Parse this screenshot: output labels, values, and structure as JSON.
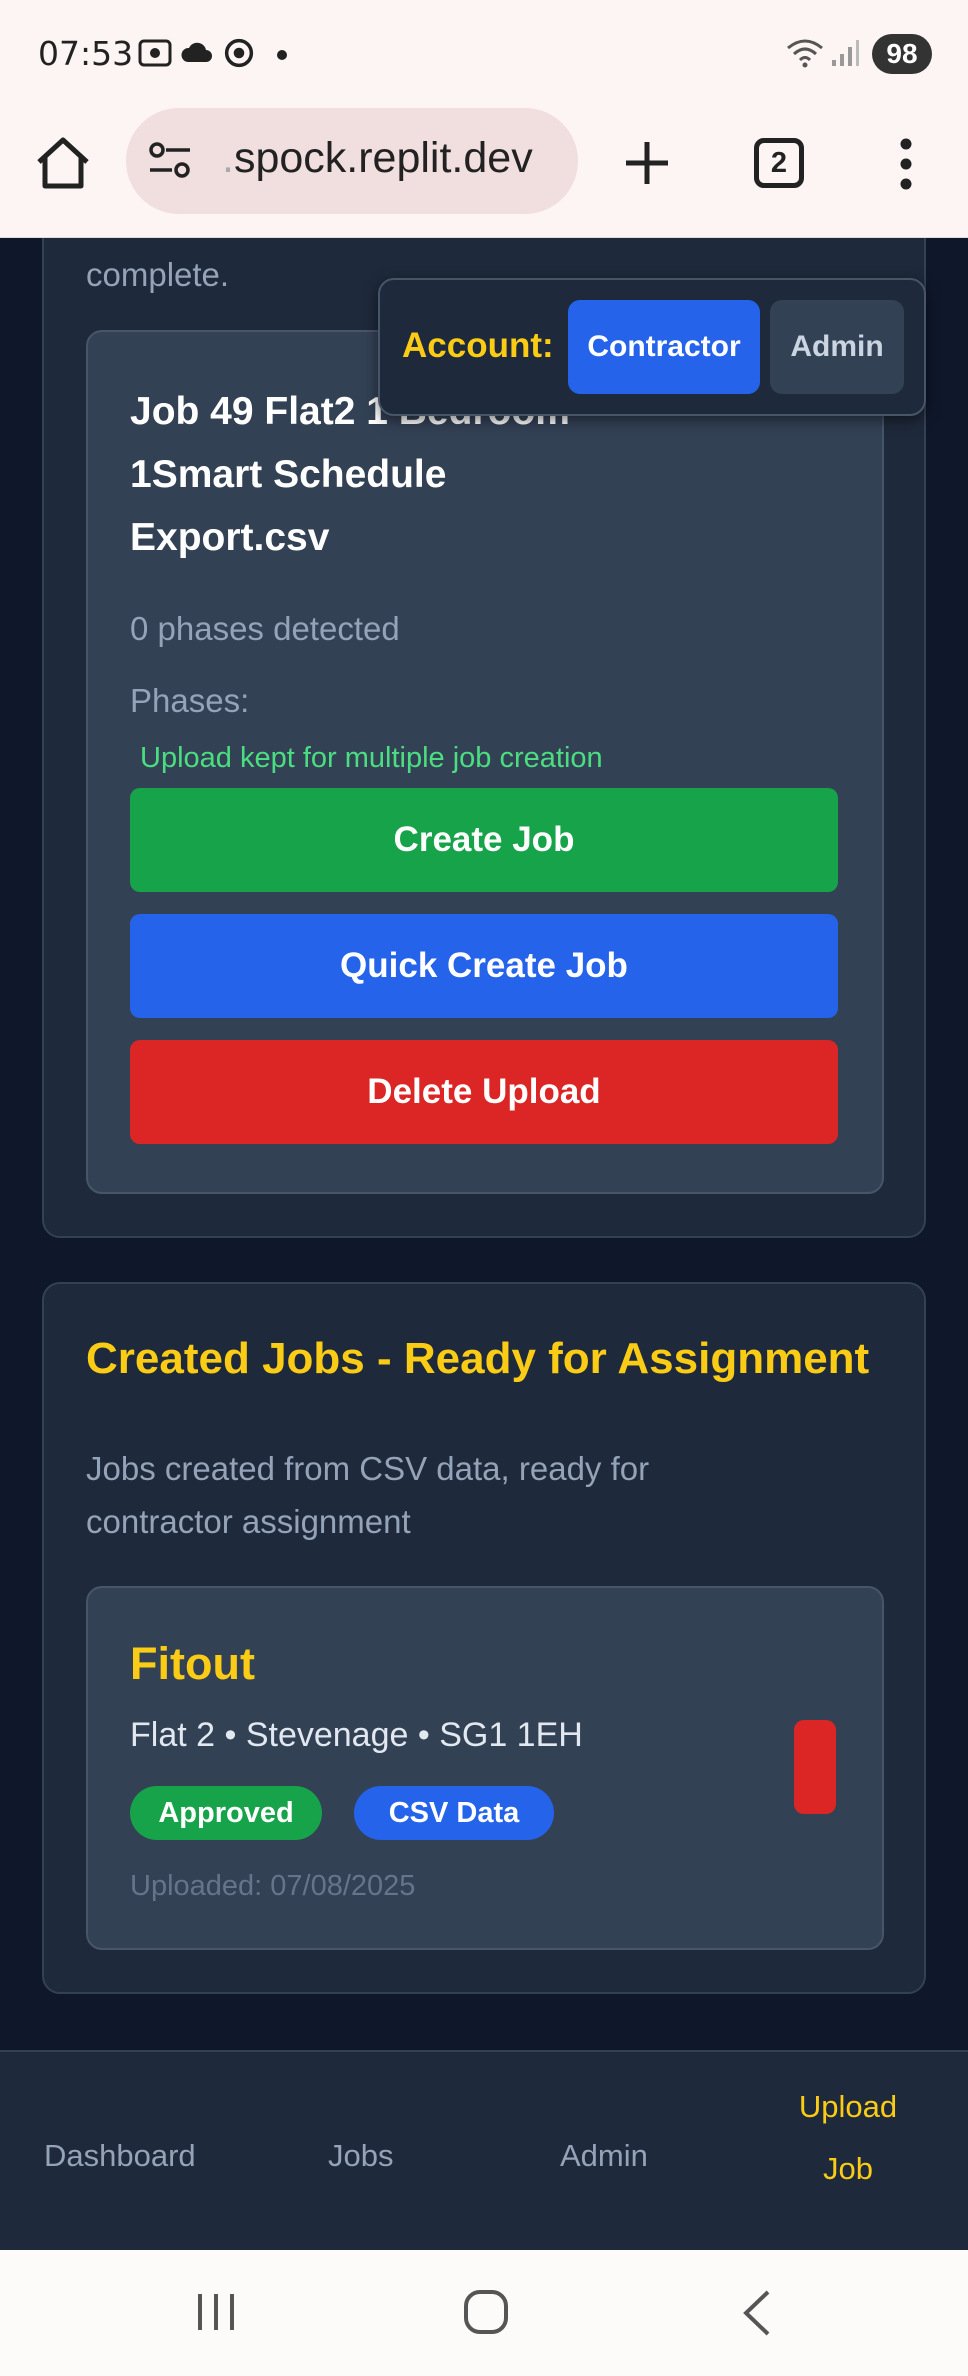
{
  "status_bar": {
    "time": "07:53",
    "battery": "98",
    "icons": [
      "screenshot-icon",
      "cloud-icon",
      "whatsapp-icon",
      "notification-dot",
      "wifi-icon",
      "signal-icon"
    ]
  },
  "browser": {
    "url_prefix": ".",
    "url": "spock.replit.dev",
    "tab_count": "2",
    "icons": [
      "home-icon",
      "site-info-icon",
      "new-tab-icon",
      "tabs-icon",
      "menu-icon"
    ]
  },
  "top_panel": {
    "tail_text": "complete.",
    "upload_card": {
      "title_line1": "Job 49 Flat2 1 Bedroom",
      "title_line2": "1Smart Schedule",
      "title_line3": "Export.csv",
      "phases_detected": "0 phases detected",
      "phases_label": "Phases:",
      "kept_note": "Upload kept for multiple job creation",
      "create_label": "Create Job",
      "quick_create_label": "Quick Create Job",
      "delete_label": "Delete Upload"
    }
  },
  "account_switcher": {
    "label": "Account:",
    "options": [
      "Contractor",
      "Admin"
    ],
    "selected": "Contractor"
  },
  "created_jobs": {
    "heading": "Created Jobs - Ready for Assignment",
    "description_line1": "Jobs created from CSV data, ready for",
    "description_line2": "contractor assignment",
    "job": {
      "title": "Fitout",
      "location": "Flat 2 • Stevenage • SG1 1EH",
      "status_badge": "Approved",
      "source_badge": "CSV Data",
      "uploaded": "Uploaded: 07/08/2025"
    }
  },
  "bottom_nav": {
    "items": [
      "Dashboard",
      "Jobs",
      "Admin"
    ],
    "active_line1": "Upload",
    "active_line2": "Job"
  },
  "colors": {
    "accent_yellow": "#facc15",
    "green": "#16a34a",
    "blue": "#2563eb",
    "red": "#dc2626",
    "page_bg": "#0f172a",
    "panel_bg": "#1e293b",
    "card_bg": "#334155"
  }
}
